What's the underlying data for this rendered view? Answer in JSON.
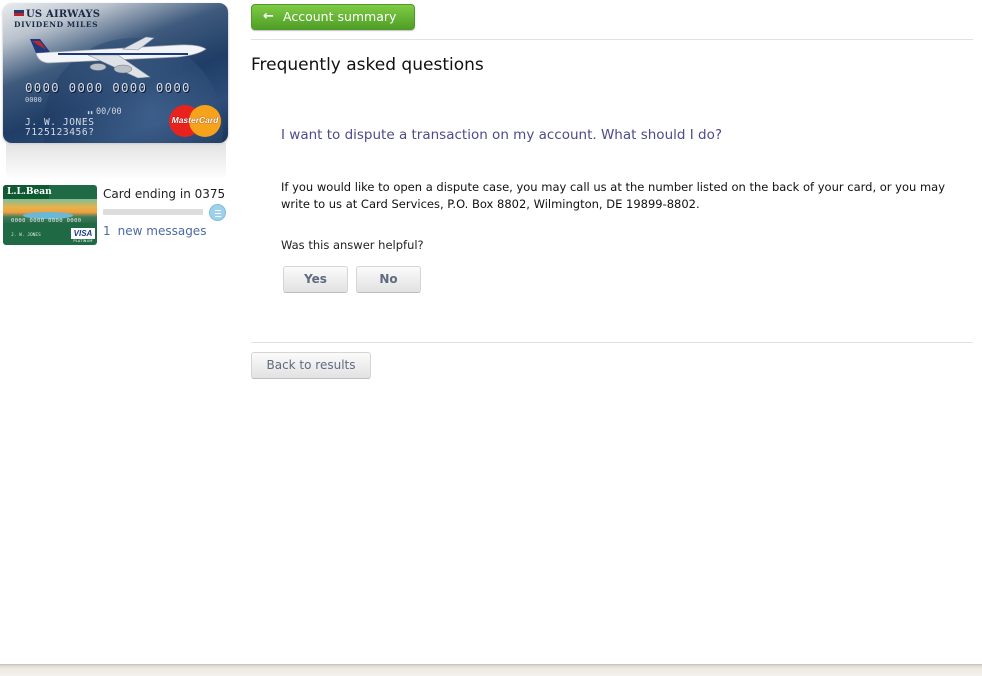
{
  "featured_card": {
    "brand_top": "US AIRWAYS",
    "brand_sub": "DIVIDEND MILES",
    "number_display": "0000 0000 0000 0000",
    "small_code": "0000",
    "valid_thru": "00/00",
    "holder": "J. W. JONES",
    "account_code": "7125123456?",
    "network_logo": "MasterCard"
  },
  "second_card": {
    "brand": "L.L.Bean",
    "number_display": "0000 0000 0000 0000",
    "holder": "J. W. JONES",
    "network_logo": "VISA",
    "tier": "PLATINUM",
    "ending_text": "Card ending in 0375",
    "messages_count": "1",
    "messages_label": "new messages"
  },
  "nav": {
    "account_summary_label": "Account summary",
    "arrow_icon": "arrow-left-icon"
  },
  "faq": {
    "title": "Frequently asked questions",
    "question": "I want to dispute a transaction on my account. What should I do?",
    "answer": "If you would like to open a dispute case, you may call us at the number listed on the back of your card, or you may write to us at Card Services, P.O. Box 8802, Wilmington, DE 19899-8802.",
    "helpful_prompt": "Was this answer helpful?",
    "yes_label": "Yes",
    "no_label": "No",
    "back_label": "Back to results"
  },
  "colors": {
    "accent_green": "#5aa92c",
    "link_blue": "#4b6aa1",
    "question_color": "#4c4c8a"
  }
}
